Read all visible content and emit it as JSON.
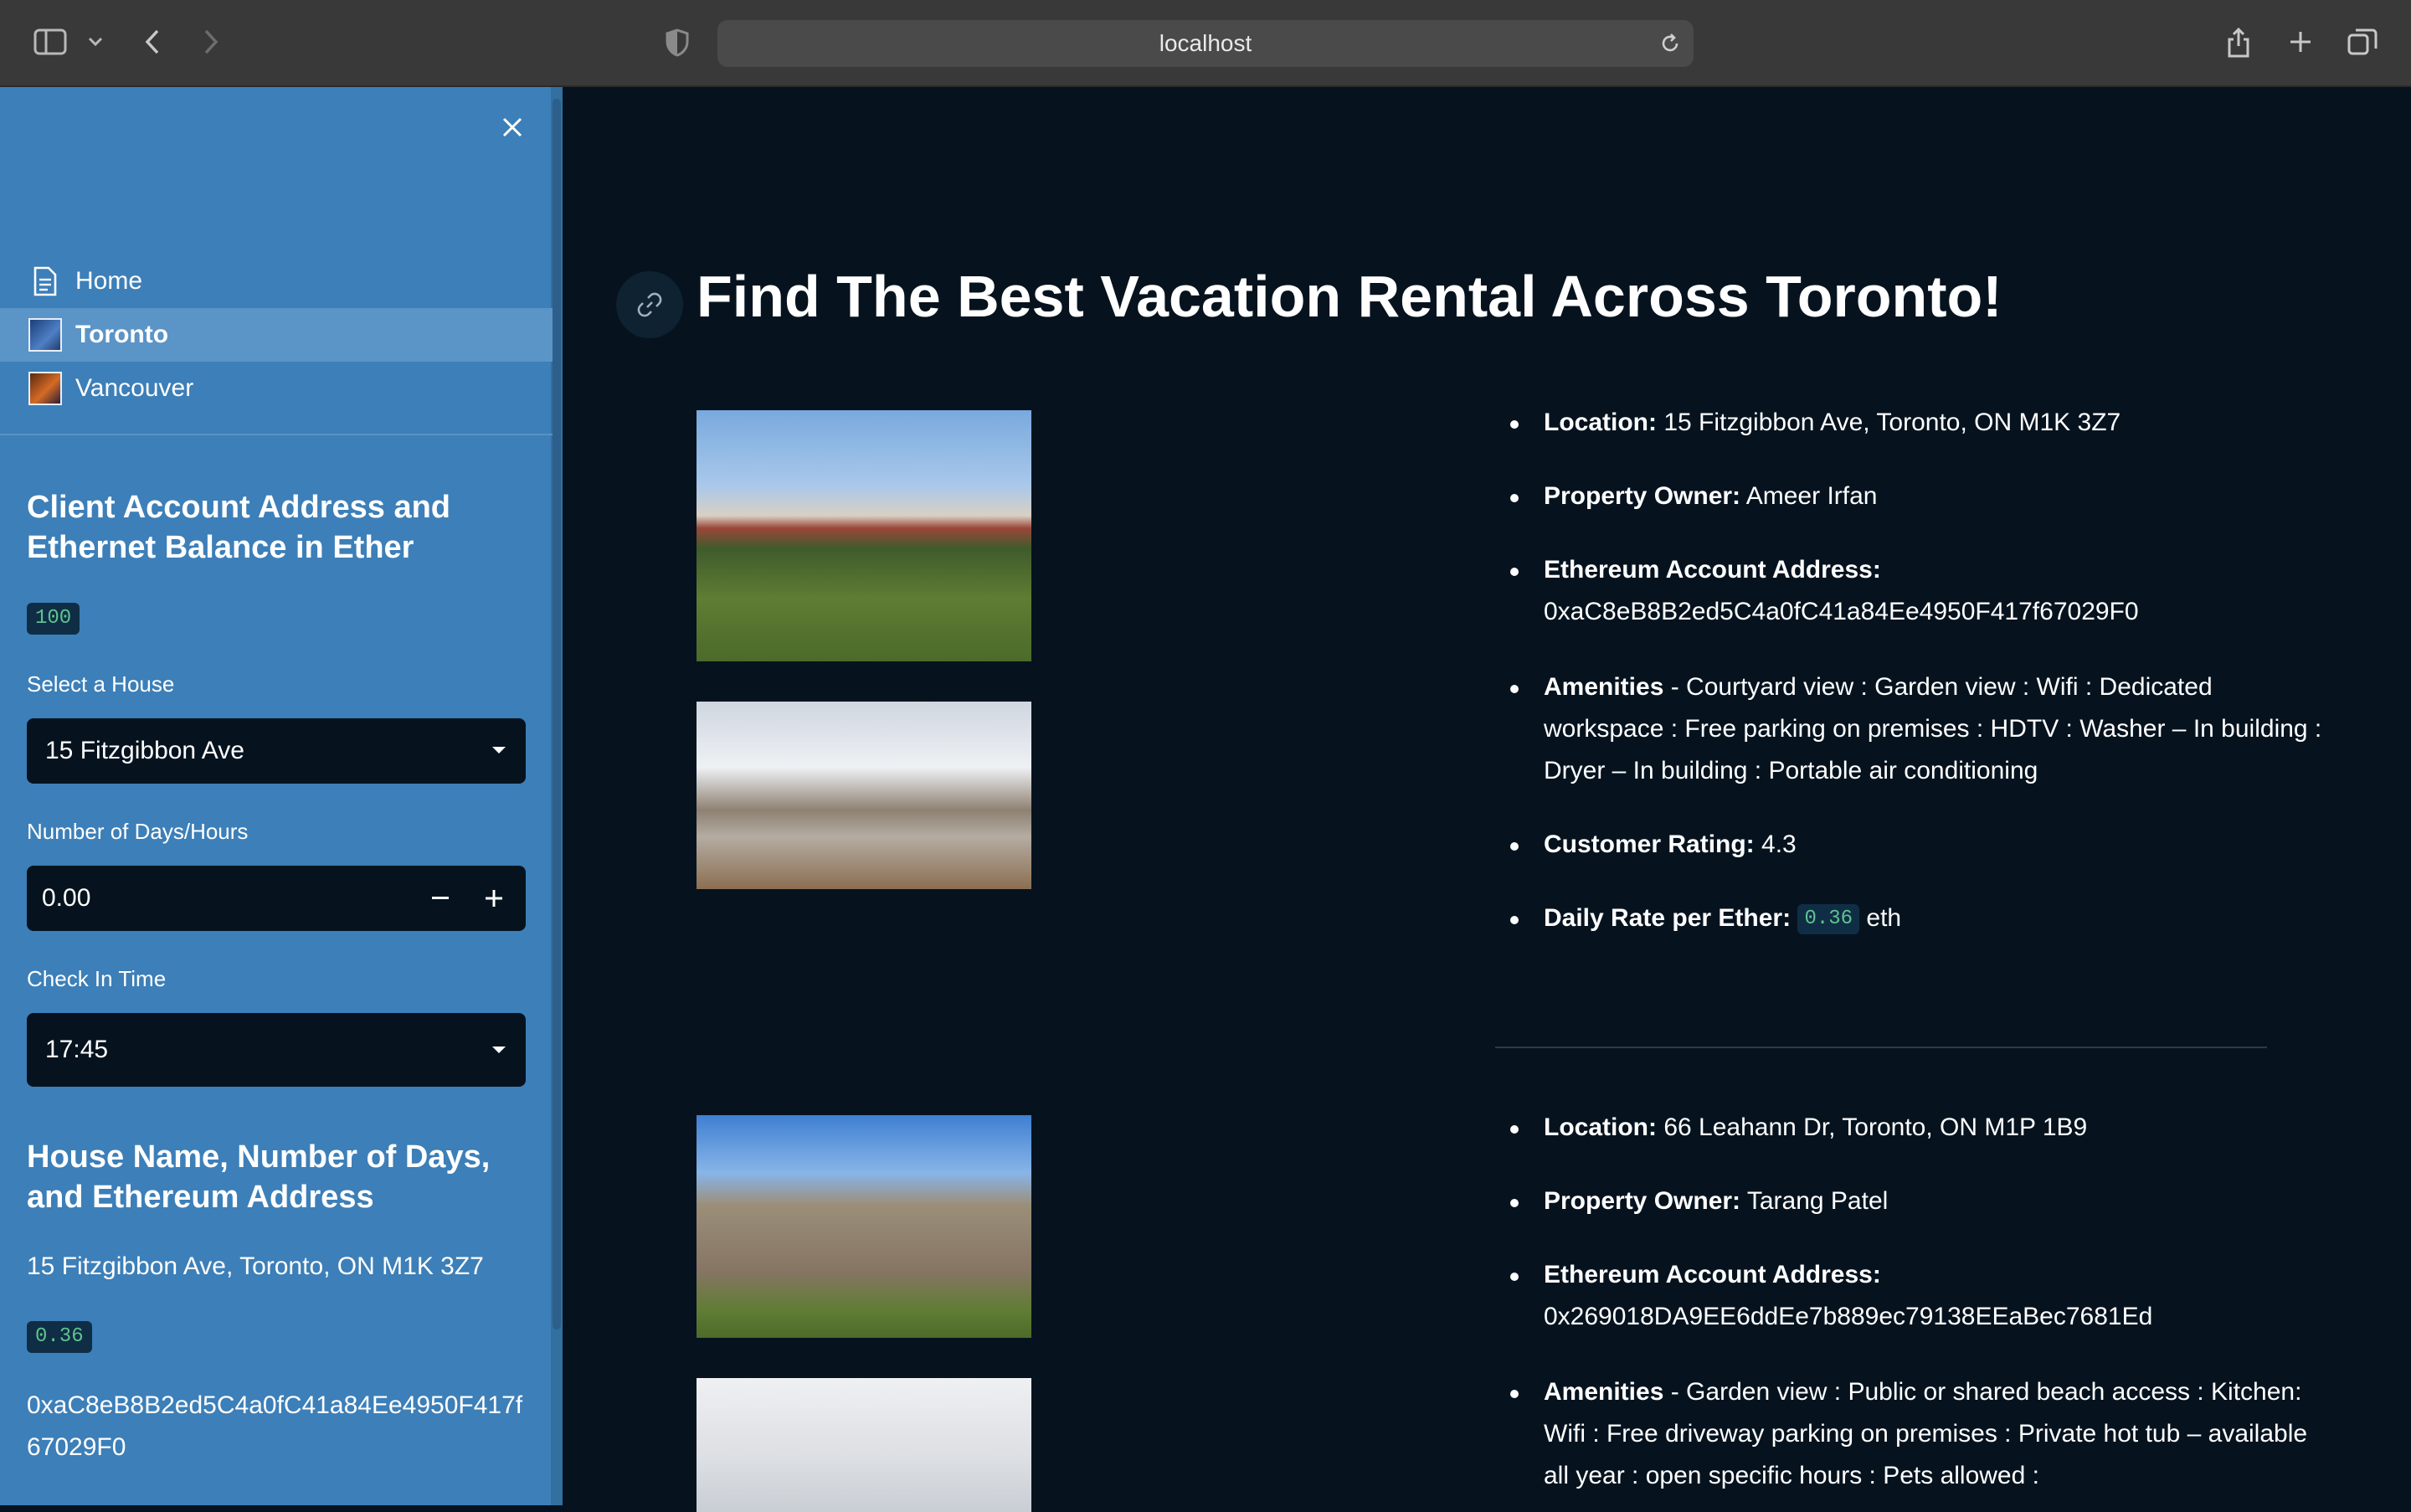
{
  "browser": {
    "url": "localhost"
  },
  "sidebar": {
    "nav": [
      {
        "label": "Home",
        "icon": "document-icon"
      },
      {
        "label": "Toronto",
        "icon": "toronto-thumbnail"
      },
      {
        "label": "Vancouver",
        "icon": "vancouver-thumbnail"
      }
    ],
    "balance_heading": "Client Account Address and Ethernet Balance in Ether",
    "balance_value": "100",
    "select_house_label": "Select a House",
    "select_house_value": "15 Fitzgibbon Ave",
    "days_label": "Number of Days/Hours",
    "days_value": "0.00",
    "checkin_label": "Check In Time",
    "checkin_value": "17:45",
    "summary_heading": "House Name, Number of Days, and Ethereum Address",
    "summary_address": "15 Fitzgibbon Ave, Toronto, ON M1K 3Z7",
    "summary_rate": "0.36",
    "summary_eth_address": "0xaC8eB8B2ed5C4a0fC41a84Ee4950F417f67029F0"
  },
  "main": {
    "title": "Find The Best Vacation Rental Across Toronto!",
    "listings": [
      {
        "location_label": "Location:",
        "location": "15 Fitzgibbon Ave, Toronto, ON M1K 3Z7",
        "owner_label": "Property Owner:",
        "owner": "Ameer Irfan",
        "eth_label": "Ethereum Account Address:",
        "eth_address": "0xaC8eB8B2ed5C4a0fC41a84Ee4950F417f67029F0",
        "amenities_label": "Amenities",
        "amenities": "- Courtyard view : Garden view : Wifi : Dedicated workspace : Free parking on premises : HDTV : Washer – In building : Dryer – In building : Portable air conditioning",
        "rating_label": "Customer Rating:",
        "rating": "4.3",
        "rate_label": "Daily Rate per Ether:",
        "rate": "0.36",
        "rate_unit": "eth"
      },
      {
        "location_label": "Location:",
        "location": "66 Leahann Dr, Toronto, ON M1P 1B9",
        "owner_label": "Property Owner:",
        "owner": "Tarang Patel",
        "eth_label": "Ethereum Account Address:",
        "eth_address": "0x269018DA9EE6ddEe7b889ec79138EEaBec7681Ed",
        "amenities_label": "Amenities",
        "amenities": "- Garden view : Public or shared beach access : Kitchen: Wifi : Free driveway parking on premises : Private hot tub – available all year : open specific hours : Pets allowed :"
      }
    ]
  }
}
